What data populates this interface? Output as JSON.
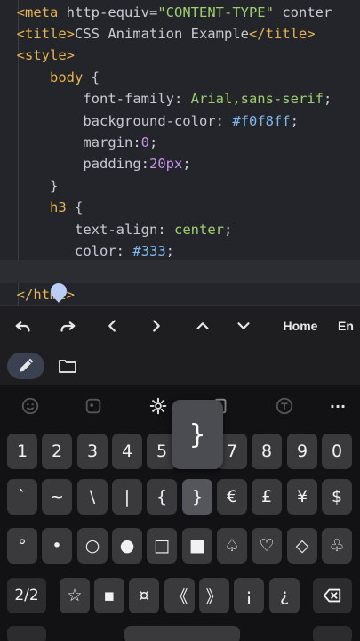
{
  "editor": {
    "line1": {
      "pre": "  ",
      "tag_open": "<meta",
      "attr": " http-equiv=",
      "str": "\"CONTENT-TYPE\"",
      "rest": " conter"
    },
    "line2": {
      "pre": "  ",
      "open": "<title>",
      "text": "CSS Animation Example",
      "close": "</title>"
    },
    "line3": {
      "pre": "  ",
      "open": "<style>"
    },
    "line4": {
      "pre": "      ",
      "sel": "body",
      "brace": " {"
    },
    "line5": {
      "pre": "          ",
      "prop": "font-family",
      "colon": ": ",
      "val": "Arial,sans-serif",
      "semi": ";"
    },
    "line6": {
      "pre": "          ",
      "prop": "background-color",
      "colon": ": ",
      "val": "#f0f8ff",
      "semi": ";"
    },
    "line7": {
      "pre": "          ",
      "prop": "margin",
      "colon": ":",
      "val": "0",
      "semi": ";"
    },
    "line8": {
      "pre": "          ",
      "prop": "padding",
      "colon": ":",
      "val": "20px",
      "semi": ";"
    },
    "line9": {
      "pre": "      ",
      "text": "}"
    },
    "line10": {
      "pre": "      ",
      "sel": "h3",
      "brace": " {"
    },
    "line11": {
      "pre": "         ",
      "prop": "text-align",
      "colon": ": ",
      "val": "center",
      "semi": ";"
    },
    "line12": {
      "pre": "         ",
      "prop": "color",
      "colon": ": ",
      "val": "#333",
      "semi": ";"
    },
    "line14": {
      "pre": "  ",
      "text": "</html>"
    }
  },
  "toolbar": {
    "undo_icon": "undo-icon",
    "redo_icon": "redo-icon",
    "left": "<",
    "right": ">",
    "up": "^",
    "home": "Home",
    "end": "En"
  },
  "filestrip": {
    "pencil_icon": "pencil-icon",
    "folder_icon": "folder-icon"
  },
  "keyboard": {
    "tools": [
      "emoji-icon",
      "sticker-icon",
      "settings-icon",
      "clipboard-icon",
      "translate-icon",
      "more-icon"
    ],
    "more_label": "···",
    "row1": [
      "1",
      "2",
      "3",
      "4",
      "5",
      "6",
      "7",
      "8",
      "9",
      "0"
    ],
    "row2": [
      "`",
      "~",
      "\\",
      "|",
      "{",
      "}",
      "€",
      "£",
      "¥",
      "$"
    ],
    "row3": [
      "°",
      "•",
      "○",
      "●",
      "□",
      "■",
      "♤",
      "♡",
      "◇",
      "♧"
    ],
    "row4": [
      "2/2",
      "☆",
      "▪",
      "¤",
      "《",
      "》",
      "¡",
      "¿"
    ],
    "popup": "}",
    "colors": {
      "key": "#3a3a3c",
      "key_dark": "#2c2c2e",
      "bg": "#121214",
      "accent": "#b9cdf7"
    }
  }
}
